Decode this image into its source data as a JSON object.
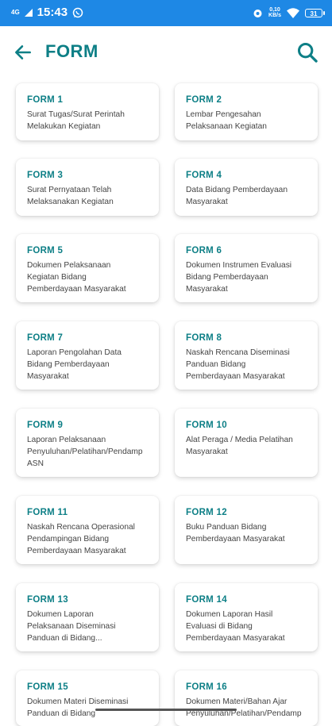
{
  "status_bar": {
    "network": "4G",
    "time": "15:43",
    "speed_value": "0,10",
    "speed_unit": "KB/s",
    "battery": "31"
  },
  "header": {
    "title": "FORM"
  },
  "forms": [
    {
      "title": "FORM 1",
      "description": "Surat Tugas/Surat Perintah\nMelakukan Kegiatan"
    },
    {
      "title": "FORM 2",
      "description": "Lembar Pengesahan\nPelaksanaan Kegiatan"
    },
    {
      "title": "FORM 3",
      "description": "Surat Pernyataan Telah\nMelaksanakan Kegiatan"
    },
    {
      "title": "FORM 4",
      "description": "Data Bidang Pemberdayaan\nMasyarakat"
    },
    {
      "title": "FORM 5",
      "description": "Dokumen Pelaksanaan\nKegiatan Bidang\nPemberdayaan Masyarakat"
    },
    {
      "title": "FORM 6",
      "description": "Dokumen Instrumen Evaluasi\nBidang Pemberdayaan\nMasyarakat"
    },
    {
      "title": "FORM 7",
      "description": "Laporan Pengolahan Data\nBidang Pemberdayaan\nMasyarakat"
    },
    {
      "title": "FORM 8",
      "description": "Naskah Rencana Diseminasi\nPanduan Bidang\nPemberdayaan Masyarakat"
    },
    {
      "title": "FORM 9",
      "description": "Laporan Pelaksanaan\nPenyuluhan/Pelatihan/Pendamp\nASN"
    },
    {
      "title": "FORM 10",
      "description": "Alat Peraga / Media Pelatihan\nMasyarakat"
    },
    {
      "title": "FORM 11",
      "description": "Naskah Rencana Operasional\nPendampingan Bidang\nPemberdayaan Masyarakat"
    },
    {
      "title": "FORM 12",
      "description": "Buku Panduan Bidang\nPemberdayaan Masyarakat"
    },
    {
      "title": "FORM 13",
      "description": "Dokumen Laporan\nPelaksanaan Diseminasi\nPanduan di Bidang..."
    },
    {
      "title": "FORM 14",
      "description": "Dokumen Laporan Hasil\nEvaluasi di Bidang\nPemberdayaan Masyarakat"
    },
    {
      "title": "FORM 15",
      "description": "Dokumen Materi Diseminasi\nPanduan di Bidang"
    },
    {
      "title": "FORM 16",
      "description": "Dokumen Materi/Bahan Ajar\nPenyuluhan/Pelatihan/Pendamp"
    }
  ],
  "colors": {
    "status_bar": "#1e88e5",
    "accent": "#0d7f86",
    "text": "#444444"
  }
}
